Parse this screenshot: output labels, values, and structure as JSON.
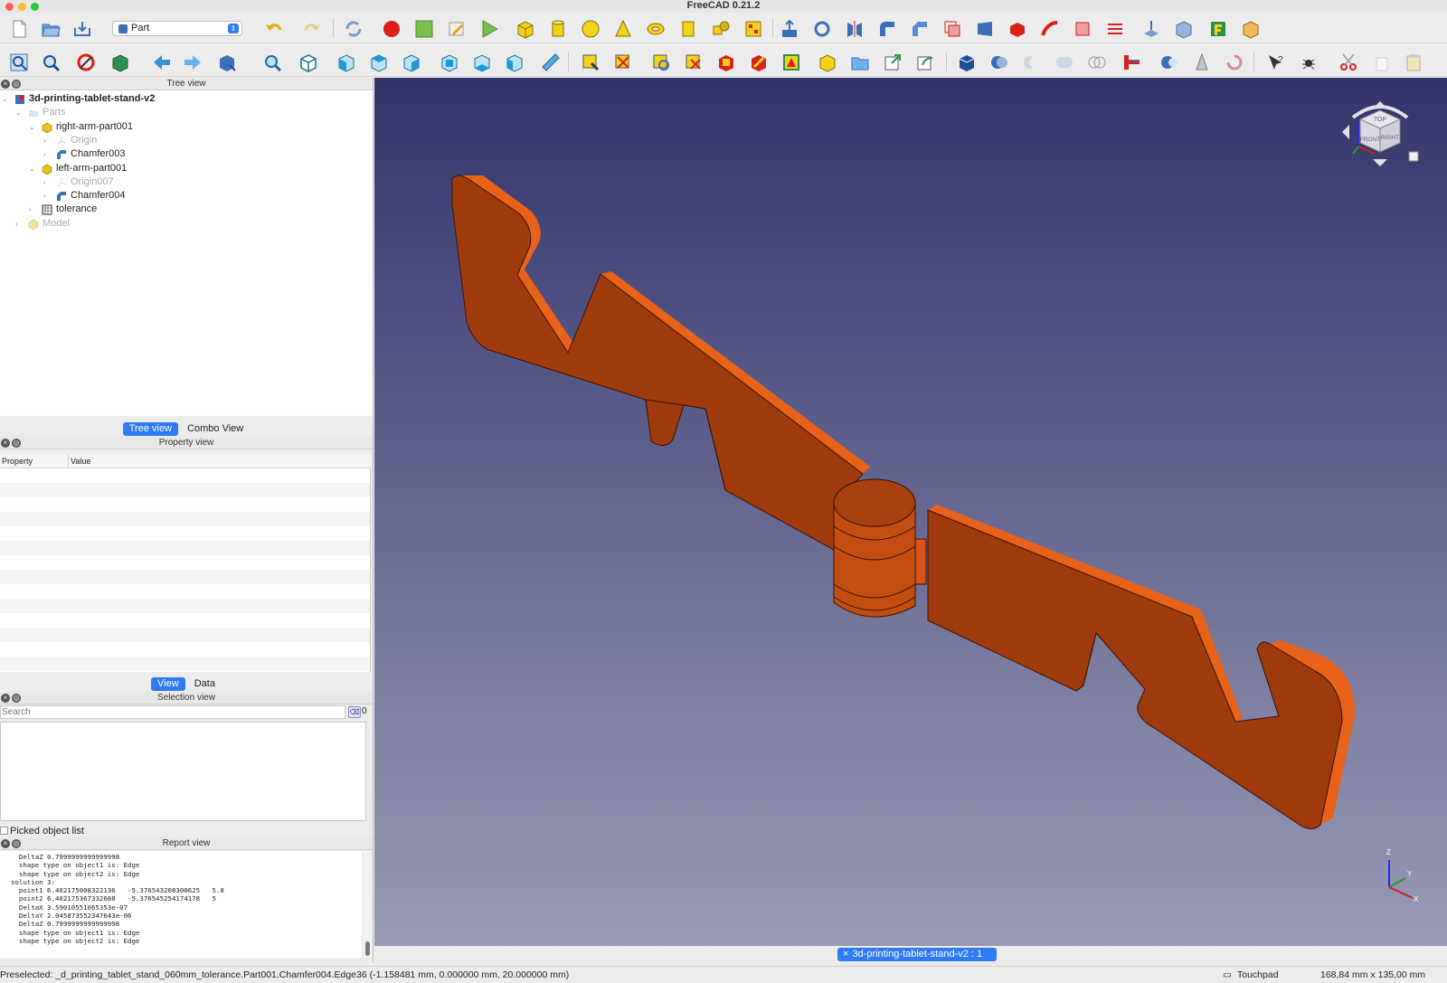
{
  "window": {
    "title": "FreeCAD 0.21.2"
  },
  "toolbar": {
    "workbench_selected": "Part"
  },
  "tree_view": {
    "title": "Tree view",
    "items": [
      {
        "label": "3d-printing-tablet-stand-v2",
        "level": 0,
        "icon": "document-icon",
        "bold": true,
        "expanded": true,
        "dim": false
      },
      {
        "label": "Parts",
        "level": 1,
        "icon": "folder-icon",
        "expanded": true,
        "dim": true
      },
      {
        "label": "right-arm-part001",
        "level": 2,
        "icon": "part-container-icon",
        "expanded": true,
        "dim": false
      },
      {
        "label": "Origin",
        "level": 3,
        "icon": "origin-icon",
        "expanded": false,
        "dim": true
      },
      {
        "label": "Chamfer003",
        "level": 3,
        "icon": "chamfer-icon",
        "expanded": false,
        "dim": false
      },
      {
        "label": "left-arm-part001",
        "level": 2,
        "icon": "part-container-icon",
        "expanded": true,
        "dim": false
      },
      {
        "label": "Origin007",
        "level": 3,
        "icon": "origin-icon",
        "expanded": false,
        "dim": true
      },
      {
        "label": "Chamfer004",
        "level": 3,
        "icon": "chamfer-icon",
        "expanded": false,
        "dim": false
      },
      {
        "label": "tolerance",
        "level": 2,
        "icon": "spreadsheet-icon",
        "expanded": false,
        "dim": false
      },
      {
        "label": "Model",
        "level": 1,
        "icon": "part-container-icon",
        "expanded": false,
        "dim": true
      }
    ],
    "tabs": [
      {
        "label": "Tree view",
        "active": true
      },
      {
        "label": "Combo View",
        "active": false
      }
    ]
  },
  "property_view": {
    "title": "Property view",
    "columns": [
      "Property",
      "Value"
    ],
    "tabs": [
      {
        "label": "View",
        "active": true
      },
      {
        "label": "Data",
        "active": false
      }
    ]
  },
  "selection_view": {
    "title": "Selection view",
    "search_placeholder": "Search",
    "count": "0",
    "picked_label": "Picked object list"
  },
  "report_view": {
    "title": "Report view",
    "lines": [
      "  DeltaZ 0.7999999999999998",
      "  shape type on object1 is: Edge",
      "  shape type on object2 is: Edge",
      "solution 3:",
      "  point1 6.402175008322136   -5.376543208300625   5.8",
      "  point2 6.402175367332688   -5.376545254174178   5",
      "  DeltaX 3.59010551065353e-07",
      "  DeltaY 2.045873552347643e-06",
      "  DeltaZ 0.7999999999999998",
      "  shape type on object1 is: Edge",
      "  shape type on object2 is: Edge"
    ]
  },
  "viewport": {
    "doc_tab": "3d-printing-tablet-stand-v2 : 1",
    "navcube": {
      "top": "TOP",
      "front": "FRONT",
      "right": "RIGHT"
    },
    "axes": {
      "x": "X",
      "y": "Y",
      "z": "Z"
    },
    "model_color": "#a53a0a",
    "model_edge_color": "#e8621a"
  },
  "statusbar": {
    "preselected": "Preselected: _d_printing_tablet_stand_060mm_tolerance.Part001.Chamfer004.Edge36 (-1.158481 mm, 0.000000 mm, 20.000000 mm)",
    "nav_style": "Touchpad",
    "dimensions": "168,84 mm x 135,00 mm"
  }
}
